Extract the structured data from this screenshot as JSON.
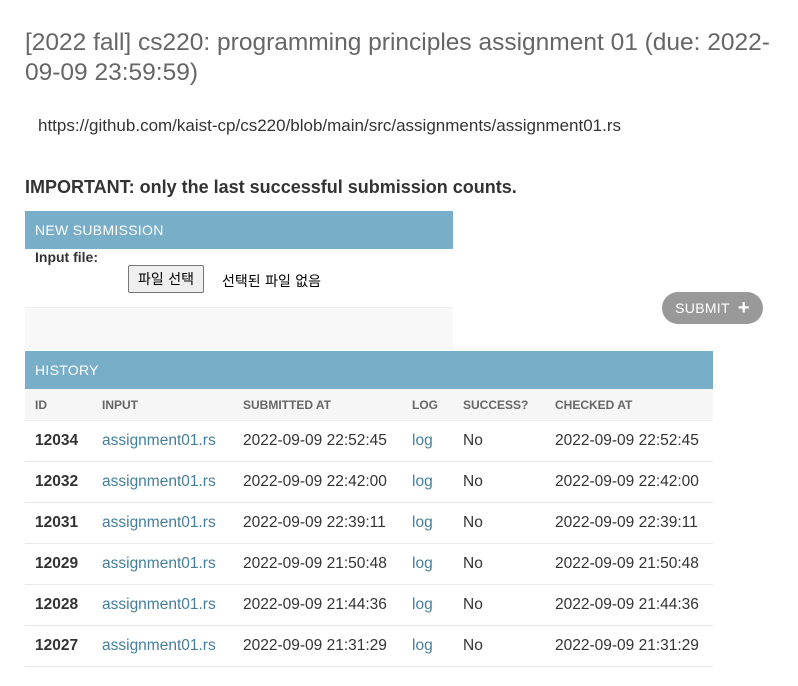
{
  "page": {
    "title": "[2022 fall] cs220: programming principles assignment 01 (due: 2022-09-09 23:59:59)",
    "url": "https://github.com/kaist-cp/cs220/blob/main/src/assignments/assignment01.rs",
    "important": "IMPORTANT: only the last successful submission counts."
  },
  "new_submission": {
    "caption": "NEW SUBMISSION",
    "input_label": "Input file:",
    "file_button": "파일 선택",
    "file_status": "선택된 파일 없음",
    "submit_label": "SUBMIT",
    "submit_icon": "plus-icon"
  },
  "history": {
    "caption": "HISTORY",
    "columns": [
      "ID",
      "INPUT",
      "SUBMITTED AT",
      "LOG",
      "SUCCESS?",
      "CHECKED AT"
    ],
    "rows": [
      {
        "id": "12034",
        "input": "assignment01.rs",
        "submitted": "2022-09-09 22:52:45",
        "log": "log",
        "success": "No",
        "checked": "2022-09-09 22:52:45"
      },
      {
        "id": "12032",
        "input": "assignment01.rs",
        "submitted": "2022-09-09 22:42:00",
        "log": "log",
        "success": "No",
        "checked": "2022-09-09 22:42:00"
      },
      {
        "id": "12031",
        "input": "assignment01.rs",
        "submitted": "2022-09-09 22:39:11",
        "log": "log",
        "success": "No",
        "checked": "2022-09-09 22:39:11"
      },
      {
        "id": "12029",
        "input": "assignment01.rs",
        "submitted": "2022-09-09 21:50:48",
        "log": "log",
        "success": "No",
        "checked": "2022-09-09 21:50:48"
      },
      {
        "id": "12028",
        "input": "assignment01.rs",
        "submitted": "2022-09-09 21:44:36",
        "log": "log",
        "success": "No",
        "checked": "2022-09-09 21:44:36"
      },
      {
        "id": "12027",
        "input": "assignment01.rs",
        "submitted": "2022-09-09 21:31:29",
        "log": "log",
        "success": "No",
        "checked": "2022-09-09 21:31:29"
      }
    ]
  },
  "colors": {
    "caption_bg": "#79aec8",
    "link": "#447e9b",
    "submit_bg": "#999999"
  }
}
